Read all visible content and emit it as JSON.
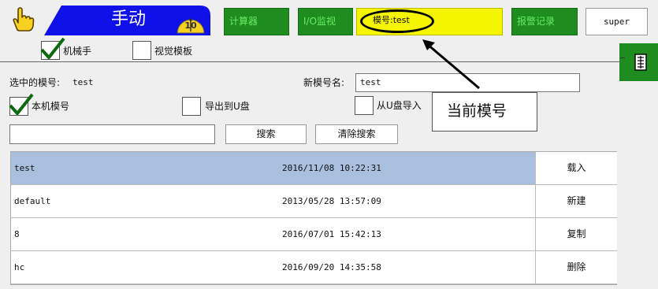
{
  "header": {
    "mode_label": "手动",
    "speed_value": "10",
    "calculator_label": "计算器",
    "io_monitor_label": "I/O监视",
    "current_mold_label": "模号:test",
    "alarm_log_label": "报警记录",
    "user_label": "super",
    "colors": {
      "mode_blue": "#1010e8",
      "nav_green": "#1e8c1e",
      "mold_yellow": "#f5f500",
      "selected_row": "#a9bfde"
    }
  },
  "tabs": {
    "robot_checked": true,
    "robot_label": "机械手",
    "vision_checked": false,
    "vision_label": "视觉模板"
  },
  "form": {
    "selected_mold_label": "选中的模号:",
    "selected_mold_value": "test",
    "new_mold_label": "新模号名:",
    "new_mold_value": "test",
    "local_mold_checked": true,
    "local_mold_label": "本机模号",
    "export_usb_checked": false,
    "export_usb_label": "导出到U盘",
    "import_usb_checked": false,
    "import_usb_label": "从U盘导入",
    "search_value": "",
    "search_button": "搜索",
    "clear_search_button": "清除搜索"
  },
  "annotation": {
    "callout_text": "当前模号"
  },
  "table": {
    "rows": [
      {
        "name": "test",
        "date": "2016/11/08 10:22:31",
        "action": "载入",
        "selected": true
      },
      {
        "name": "default",
        "date": "2013/05/28 13:57:09",
        "action": "新建",
        "selected": false
      },
      {
        "name": "8",
        "date": "2016/07/01 15:42:13",
        "action": "复制",
        "selected": false
      },
      {
        "name": "hc",
        "date": "2016/09/20 14:35:58",
        "action": "删除",
        "selected": false
      }
    ]
  }
}
